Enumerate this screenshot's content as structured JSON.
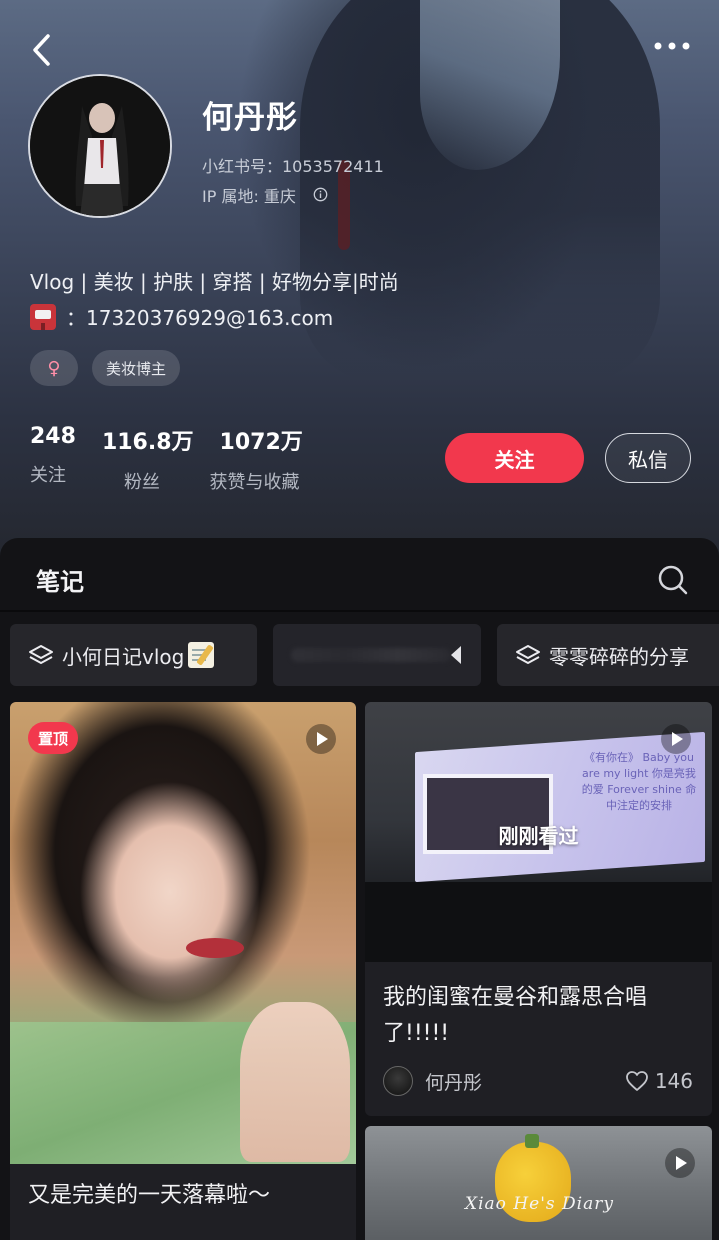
{
  "profile": {
    "name": "何丹彤",
    "id_line": "小红书号：1053572411",
    "ip_line": "IP 属地: 重庆",
    "bio": "Vlog | 美妆 | 护肤 | 穿搭  | 好物分享|时尚",
    "email": "：17320376929@163.com",
    "tags": [
      "♀",
      "美妆博主"
    ]
  },
  "stats": [
    {
      "value": "248",
      "label": "关注"
    },
    {
      "value": "116.8万",
      "label": "粉丝"
    },
    {
      "value": "1072万",
      "label": "获赞与收藏"
    }
  ],
  "actions": {
    "follow": "关注",
    "message": "私信"
  },
  "section": {
    "title": "笔记"
  },
  "albums": [
    {
      "label": "小何日记vlog"
    },
    {
      "label": ""
    },
    {
      "label": "零零碎碎的分享"
    }
  ],
  "notes": [
    {
      "badge": "置顶",
      "title": "又是完美的一天落幕啦～"
    },
    {
      "overlay": "刚刚看过",
      "screen_text": "《有你在》 Baby you are my light 你是亮我的爱 Forever shine 命中注定的安排",
      "title": "我的闺蜜在曼谷和露思合唱了!!!!!",
      "author": "何丹彤",
      "likes": "146"
    },
    {
      "watermark": "Xiao He's Diary"
    }
  ],
  "colors": {
    "accent": "#f2384d",
    "panel": "#131316",
    "card": "#1f1f24"
  }
}
